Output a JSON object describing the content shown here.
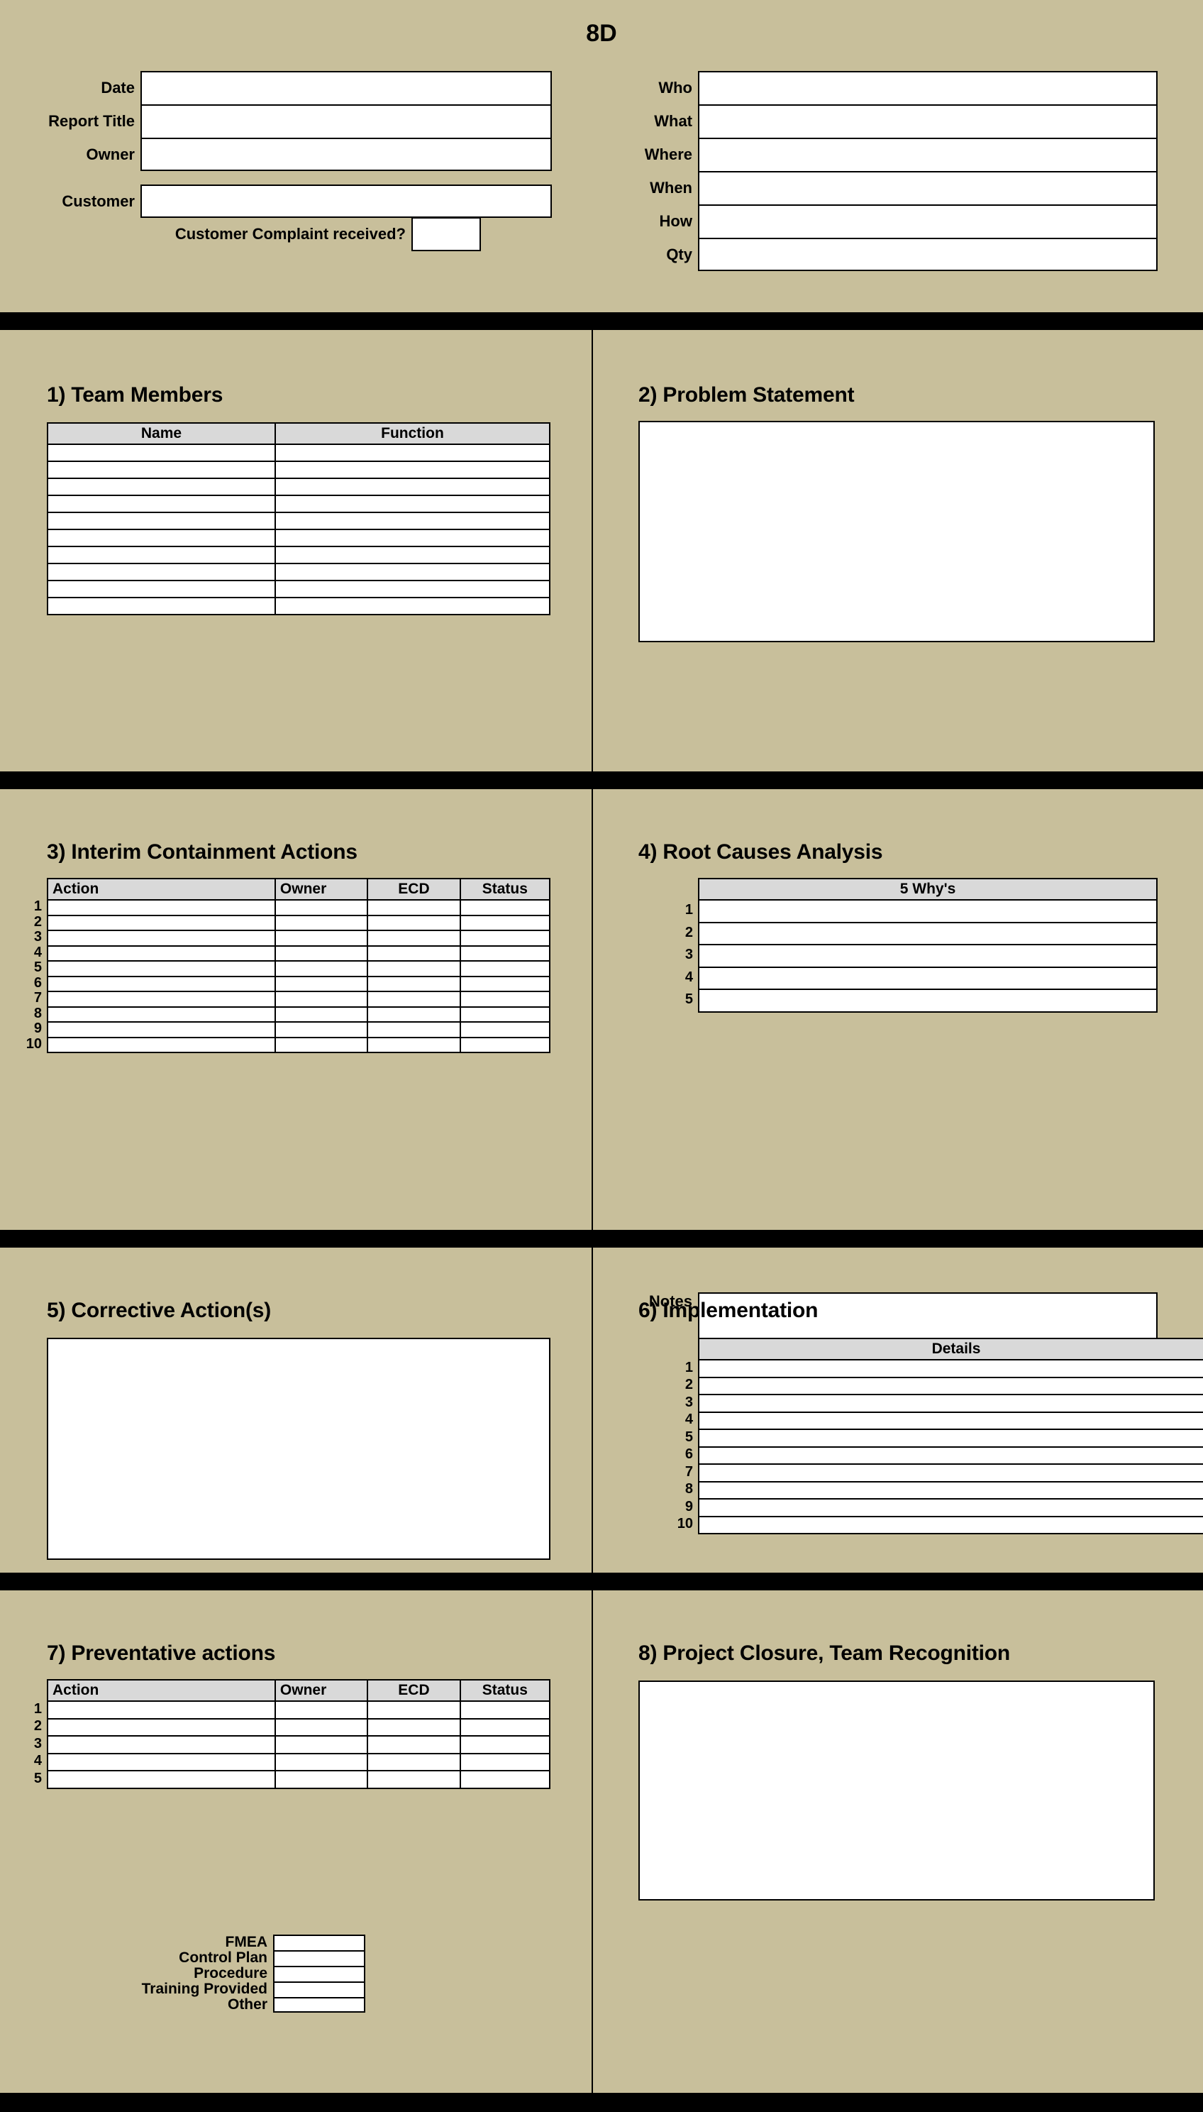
{
  "document": {
    "title": "8D",
    "background_color": "#c8bf9b",
    "header_fill_color": "#d9d9d9",
    "field_fill_color": "#ffffff",
    "divider_color": "#000000"
  },
  "header": {
    "left_fields": [
      {
        "label": "Date",
        "value": ""
      },
      {
        "label": "Report Title",
        "value": ""
      },
      {
        "label": "Owner",
        "value": ""
      }
    ],
    "customer": {
      "label": "Customer",
      "value": ""
    },
    "complaint": {
      "label": "Customer Complaint received?",
      "value": ""
    },
    "right_fields": [
      {
        "label": "Who",
        "value": ""
      },
      {
        "label": "What",
        "value": ""
      },
      {
        "label": "Where",
        "value": ""
      },
      {
        "label": "When",
        "value": ""
      },
      {
        "label": "How",
        "value": ""
      },
      {
        "label": "Qty",
        "value": ""
      }
    ]
  },
  "section1": {
    "title": "1) Team Members",
    "columns": [
      "Name",
      "Function"
    ],
    "rows": [
      [
        "",
        ""
      ],
      [
        "",
        ""
      ],
      [
        "",
        ""
      ],
      [
        "",
        ""
      ],
      [
        "",
        ""
      ],
      [
        "",
        ""
      ],
      [
        "",
        ""
      ],
      [
        "",
        ""
      ],
      [
        "",
        ""
      ],
      [
        "",
        ""
      ]
    ]
  },
  "section2": {
    "title": "2) Problem Statement",
    "value": ""
  },
  "section3": {
    "title": "3) Interim Containment Actions",
    "columns": [
      "Action",
      "Owner",
      "ECD",
      "Status"
    ],
    "row_numbers": [
      "1",
      "2",
      "3",
      "4",
      "5",
      "6",
      "7",
      "8",
      "9",
      "10"
    ],
    "rows": [
      [
        "",
        "",
        "",
        ""
      ],
      [
        "",
        "",
        "",
        ""
      ],
      [
        "",
        "",
        "",
        ""
      ],
      [
        "",
        "",
        "",
        ""
      ],
      [
        "",
        "",
        "",
        ""
      ],
      [
        "",
        "",
        "",
        ""
      ],
      [
        "",
        "",
        "",
        ""
      ],
      [
        "",
        "",
        "",
        ""
      ],
      [
        "",
        "",
        "",
        ""
      ],
      [
        "",
        "",
        "",
        ""
      ]
    ]
  },
  "section4": {
    "title": "4) Root Causes Analysis",
    "columns": [
      "5 Why's"
    ],
    "row_numbers": [
      "1",
      "2",
      "3",
      "4",
      "5"
    ],
    "rows": [
      [
        ""
      ],
      [
        ""
      ],
      [
        ""
      ],
      [
        ""
      ],
      [
        ""
      ]
    ],
    "notes": {
      "label": "Notes",
      "value": ""
    }
  },
  "section5": {
    "title": "5) Corrective Action(s)",
    "value": ""
  },
  "section6": {
    "title": "6) Implementation",
    "columns": [
      "Details"
    ],
    "row_numbers": [
      "1",
      "2",
      "3",
      "4",
      "5",
      "6",
      "7",
      "8",
      "9",
      "10"
    ],
    "rows": [
      [
        ""
      ],
      [
        ""
      ],
      [
        ""
      ],
      [
        ""
      ],
      [
        ""
      ],
      [
        ""
      ],
      [
        ""
      ],
      [
        ""
      ],
      [
        ""
      ],
      [
        ""
      ]
    ]
  },
  "section7": {
    "title": "7) Preventative actions",
    "columns": [
      "Action",
      "Owner",
      "ECD",
      "Status"
    ],
    "row_numbers": [
      "1",
      "2",
      "3",
      "4",
      "5"
    ],
    "rows": [
      [
        "",
        "",
        "",
        ""
      ],
      [
        "",
        "",
        "",
        ""
      ],
      [
        "",
        "",
        "",
        ""
      ],
      [
        "",
        "",
        "",
        ""
      ],
      [
        "",
        "",
        "",
        ""
      ]
    ],
    "checklist": [
      {
        "label": "FMEA",
        "value": ""
      },
      {
        "label": "Control Plan",
        "value": ""
      },
      {
        "label": "Procedure",
        "value": ""
      },
      {
        "label": "Training Provided",
        "value": ""
      },
      {
        "label": "Other",
        "value": ""
      }
    ]
  },
  "section8": {
    "title": "8) Project Closure, Team Recognition",
    "value": ""
  }
}
